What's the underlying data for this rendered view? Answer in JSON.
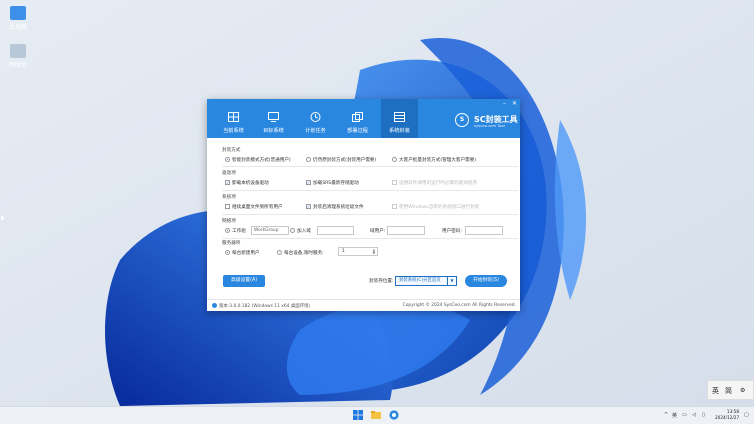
{
  "desktop": {
    "icons": [
      {
        "label": "此电脑",
        "icon": "computer-icon"
      },
      {
        "label": "回收站",
        "icon": "recycle-bin-icon"
      }
    ]
  },
  "app": {
    "tabs": [
      {
        "label": "当前系统",
        "icon": "grid-icon"
      },
      {
        "label": "目标系统",
        "icon": "monitor-icon"
      },
      {
        "label": "计划任务",
        "icon": "clock-icon"
      },
      {
        "label": "部署过程",
        "icon": "copy-icon"
      },
      {
        "label": "系统封装",
        "icon": "package-icon",
        "active": true
      }
    ],
    "brand": {
      "title": "SC封装工具",
      "subtitle": "sysceo.com Tool"
    },
    "window_controls": {
      "min": "–",
      "close": "✕"
    },
    "section_mode": {
      "title": "封装方式",
      "options": [
        {
          "label": "智能封装模式方式(普通用户)",
          "selected": true
        },
        {
          "label": "仍然原封装方式(封装用户需要)",
          "selected": false
        },
        {
          "label": "大客户批量封装方式(管理大客户需要)",
          "selected": false
        }
      ]
    },
    "section_driver": {
      "title": "驱动项",
      "options": [
        {
          "label": "卸载本机设备驱动",
          "checked": true,
          "disabled": false
        },
        {
          "label": "加载SRS最新存储驱动",
          "checked": true,
          "disabled": false
        },
        {
          "label": "运用软件调用的运行时必需的驱动程序",
          "checked": false,
          "disabled": true
        }
      ]
    },
    "section_system": {
      "title": "系统项",
      "options": [
        {
          "label": "继续桌面文件到所有用户",
          "checked": false,
          "disabled": false
        },
        {
          "label": "封装后清理系统垃圾文件",
          "checked": true,
          "disabled": false
        },
        {
          "label": "使用Windows自带的系统接口进行封装",
          "checked": false,
          "disabled": true
        }
      ]
    },
    "section_network": {
      "title": "网络项",
      "workgroup_label": "工作组",
      "workgroup_value": "WorkGroup",
      "domain_label": "加入域",
      "domain_value": "",
      "user_label": "域用户:",
      "user_value": "",
      "password_label": "用户密码:",
      "password_value": ""
    },
    "section_service": {
      "title": "服务器项",
      "option1": "每台新建用户",
      "option2": "每台设备,限时服务:",
      "spin_value": "1"
    },
    "buttons": {
      "advanced": "高级设置(A)",
      "start": "开始封装(S)"
    },
    "location_label": "封装存位置:",
    "location_value": "封装系统(C)分区首页",
    "footer": {
      "version": "版本:3.0.0.182 (Windows 11 x64 桌面环境)",
      "copyright": "Copyright © 2024 SysCeo.com All Rights Reserved."
    }
  },
  "taskbar": {
    "ime": {
      "a": "英",
      "b": "简"
    },
    "tray": {
      "lang": "英"
    },
    "clock": {
      "time": "13:58",
      "date": "2024/12/27"
    }
  },
  "colors": {
    "accent": "#2a87e0",
    "accent_dark": "#1e6fc2"
  }
}
